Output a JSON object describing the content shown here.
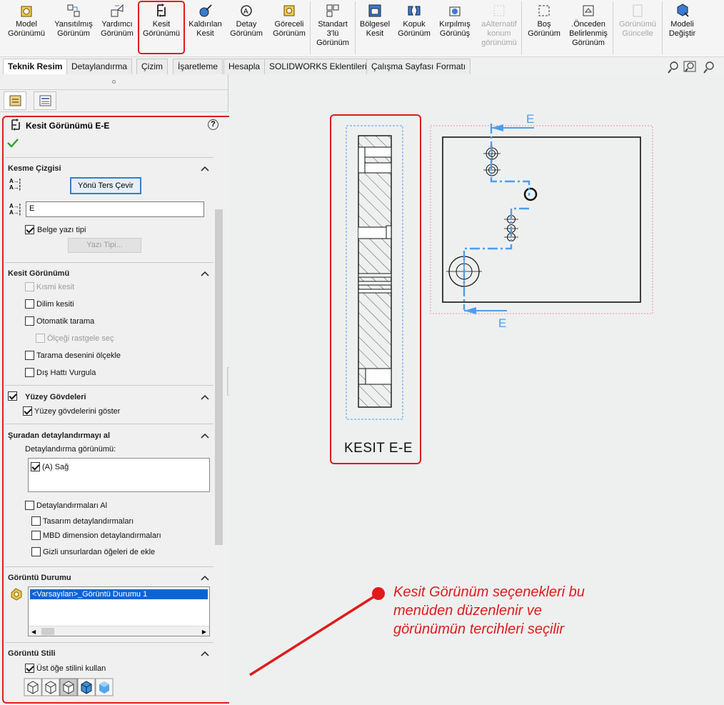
{
  "ribbon": {
    "buttons": [
      {
        "id": "model",
        "label": "Model\nGörünümü",
        "icon": "model-view-icon"
      },
      {
        "id": "mirror",
        "label": "Yansıtılmış\nGörünüm",
        "icon": "projected-view-icon"
      },
      {
        "id": "aux",
        "label": "Yardımcı\nGörünüm",
        "icon": "auxiliary-view-icon"
      },
      {
        "id": "section",
        "label": "Kesit\nGörünümü",
        "icon": "section-view-icon"
      },
      {
        "id": "removed",
        "label": "Kaldırılan\nKesit",
        "icon": "removed-section-icon"
      },
      {
        "id": "detail",
        "label": "Detay\nGörünüm",
        "icon": "detail-view-icon"
      },
      {
        "id": "relative",
        "label": "Göreceli\nGörünüm",
        "icon": "relative-view-icon"
      },
      {
        "id": "standard",
        "label": "Standart\n3'lü\nGörünüm",
        "icon": "standard-3-view-icon"
      },
      {
        "id": "broken_out",
        "label": "Bölgesel\nKesit",
        "icon": "broken-out-section-icon"
      },
      {
        "id": "break",
        "label": "Kopuk\nGörünüm",
        "icon": "break-view-icon"
      },
      {
        "id": "crop",
        "label": "Kırpılmış\nGörünüş",
        "icon": "crop-view-icon"
      },
      {
        "id": "alternate",
        "label": "aAlternatif\nkonum\ngörünümü",
        "icon": "alternate-position-icon",
        "disabled": true
      },
      {
        "id": "empty",
        "label": "Boş\nGörünüm",
        "icon": "empty-view-icon"
      },
      {
        "id": "predefined",
        "label": ".Önceden\nBelirlenmiş\nGörünüm",
        "icon": "predefined-view-icon"
      },
      {
        "id": "update",
        "label": "Görünümü\nGüncelle",
        "icon": "update-view-icon",
        "disabled": true
      },
      {
        "id": "replace",
        "label": "Modeli\nDeğiştir",
        "icon": "replace-model-icon"
      }
    ]
  },
  "tabs": [
    "Teknik Resim",
    "Detaylandırma",
    "Çizim",
    "İşaretleme",
    "Hesapla",
    "SOLIDWORKS Eklentileri",
    "Çalışma Sayfası Formatı"
  ],
  "panel": {
    "title": "Kesit Görünümü E-E",
    "help": "?",
    "cutting_line": {
      "title": "Kesme Çizgisi",
      "flip_button": "Yönü Ters Çevir",
      "label_value": "E",
      "doc_font_label": "Belge yazı tipi",
      "font_button": "Yazı Tipi..."
    },
    "section_view": {
      "title": "Kesit Görünümü",
      "partial": "Kısmi kesit",
      "slice": "Dilim kesiti",
      "auto_hatch": "Otomatik tarama",
      "random_scale": "Ölçeği rastgele seç",
      "scale_hatch": "Tarama desenini ölçekle",
      "emphasize": "Dış Hattı Vurgula"
    },
    "surface_bodies": {
      "title": "Yüzey Gövdeleri",
      "show": "Yüzey gövdelerini göster"
    },
    "import_annotations": {
      "title": "Şuradan detaylandırmayı al",
      "subtitle": "Detaylandırma görünümü:",
      "list_item": "(A) Sağ",
      "import": "Detaylandırmaları Al",
      "design": "Tasarım detaylandırmaları",
      "mbd": "MBD dimension detaylandırmaları",
      "hidden": "Gizli unsurlardan öğeleri de ekle"
    },
    "display_state": {
      "title": "Görüntü Durumu",
      "item": "<Varsayılan>_Görüntü Durumu 1"
    },
    "display_style": {
      "title": "Görüntü Stili",
      "use_parent": "Üst öğe stilini kullan"
    }
  },
  "drawing": {
    "section_label": "KESIT E-E",
    "arrow_label_top": "E",
    "arrow_label_bottom": "E"
  },
  "callout": {
    "lines": [
      "Kesit Görünüm seçenekleri bu",
      "menüden düzenlenir ve",
      "görünümün tercihleri seçilir"
    ]
  },
  "colors": {
    "highlight": "#e01b1b",
    "section_line": "#4a9eef",
    "accent": "#3b7bd2"
  }
}
